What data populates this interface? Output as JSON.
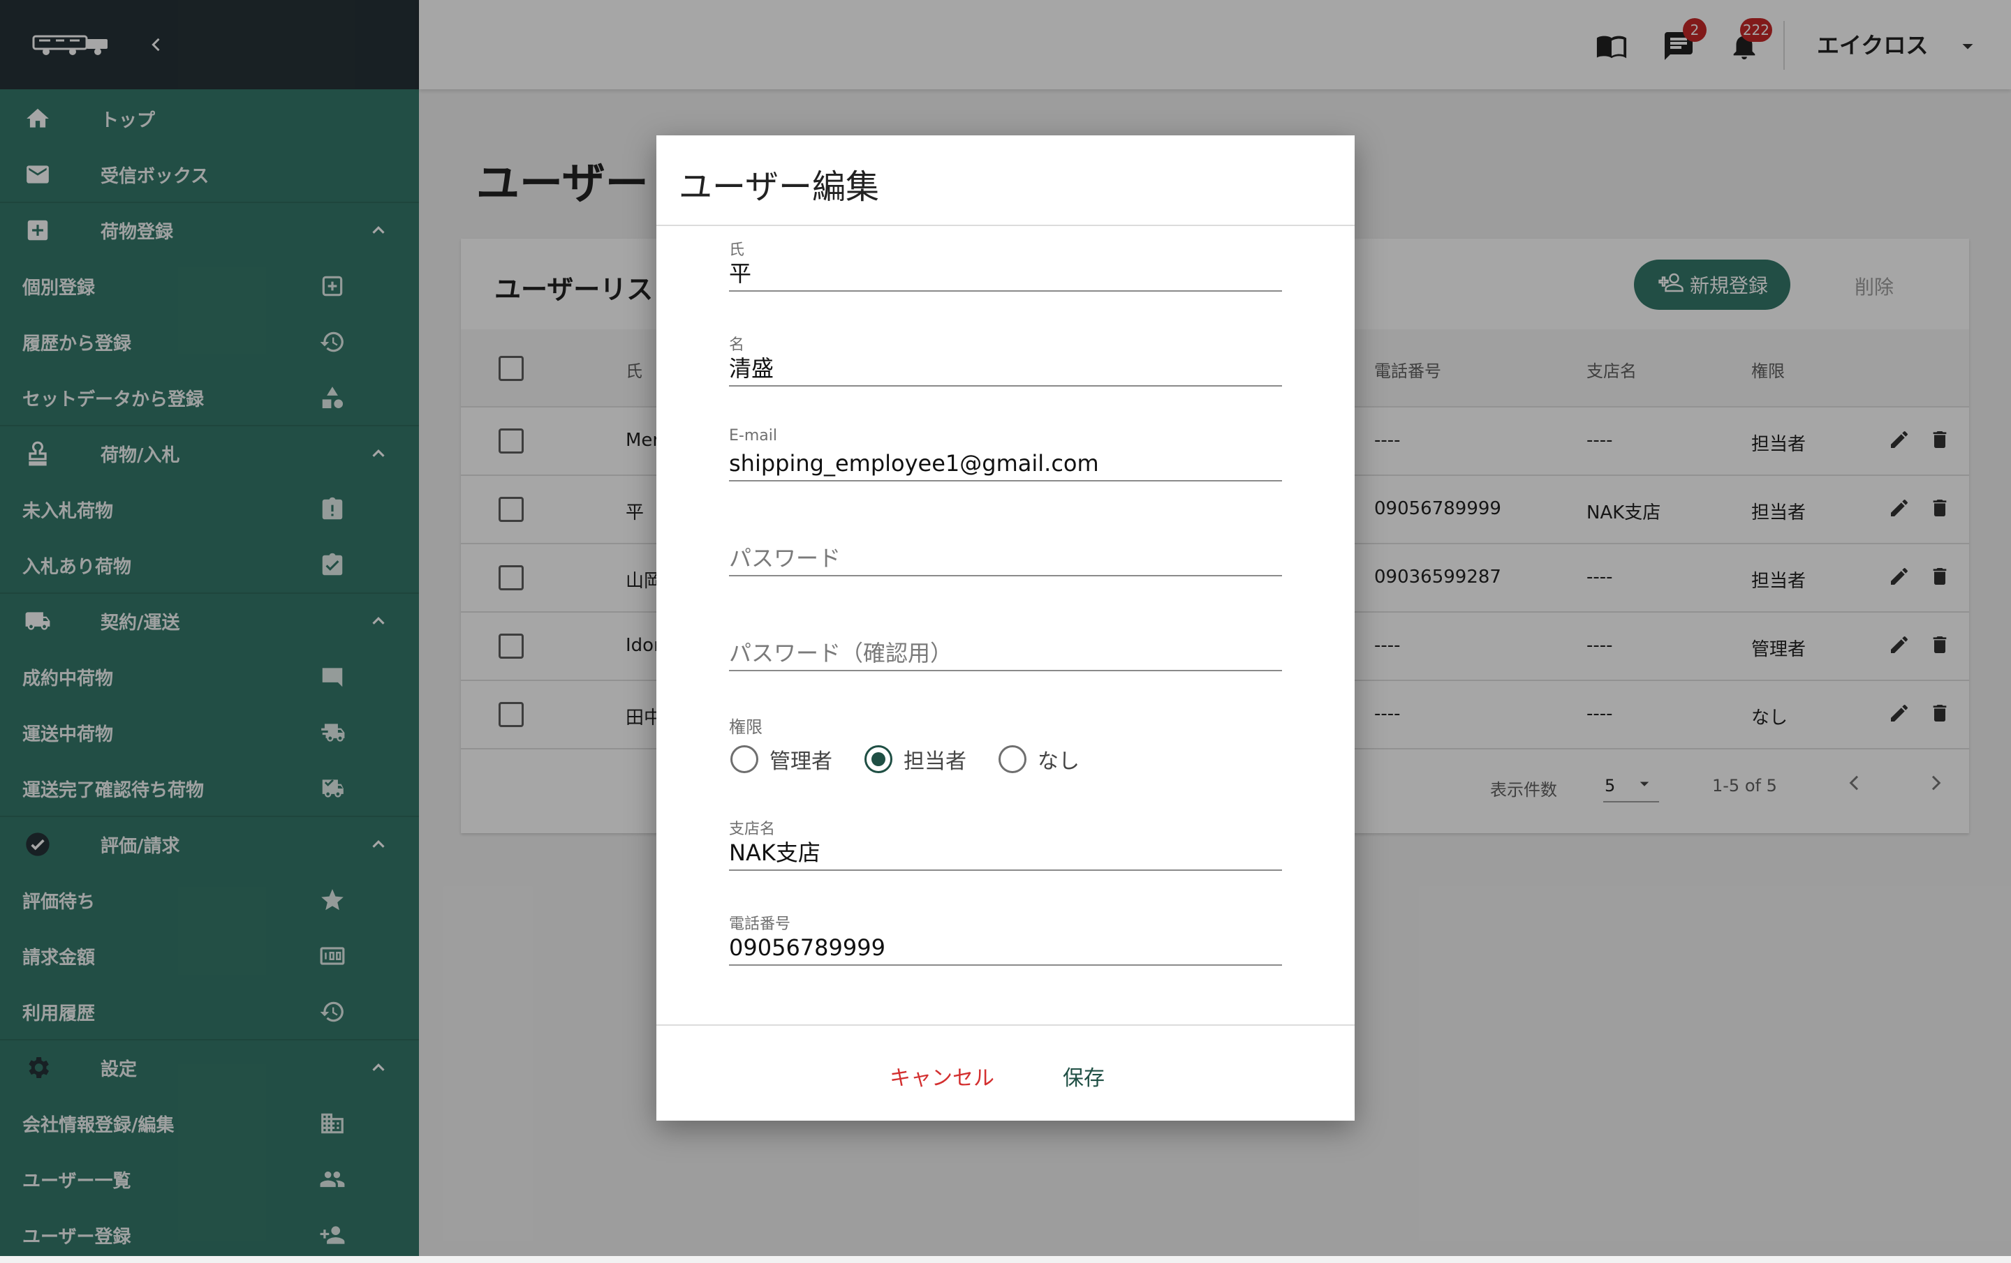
{
  "sidebar": {
    "menu": [
      {
        "label": "トップ",
        "icon": "home-icon"
      },
      {
        "label": "受信ボックス",
        "icon": "mail-icon"
      },
      {
        "label": "荷物登録",
        "icon": "add-box-icon"
      },
      {
        "label": "個別登録",
        "icon": "add-square-icon"
      },
      {
        "label": "履歴から登録",
        "icon": "history-icon"
      },
      {
        "label": "セットデータから登録",
        "icon": "shapes-icon"
      },
      {
        "label": "荷物/入札",
        "icon": "stamp-icon"
      },
      {
        "label": "未入札荷物",
        "icon": "clipboard-alert-icon"
      },
      {
        "label": "入札あり荷物",
        "icon": "clipboard-check-icon"
      },
      {
        "label": "契約/運送",
        "icon": "truck-icon"
      },
      {
        "label": "成約中荷物",
        "icon": "comment-icon"
      },
      {
        "label": "運送中荷物",
        "icon": "truck-fast-icon"
      },
      {
        "label": "運送完了確認待ち荷物",
        "icon": "truck-check-icon"
      },
      {
        "label": "評価/請求",
        "icon": "check-circle-icon"
      },
      {
        "label": "評価待ち",
        "icon": "star-icon"
      },
      {
        "label": "請求金額",
        "icon": "money-icon"
      },
      {
        "label": "利用履歴",
        "icon": "history-icon"
      },
      {
        "label": "設定",
        "icon": "gear-icon"
      },
      {
        "label": "会社情報登録/編集",
        "icon": "building-icon"
      },
      {
        "label": "ユーザー一覧",
        "icon": "people-icon"
      },
      {
        "label": "ユーザー登録",
        "icon": "person-add-icon"
      }
    ]
  },
  "header": {
    "message_badge": "2",
    "notification_badge": "222",
    "company": "エイクロス"
  },
  "main": {
    "page_title": "ユーザー",
    "card_title": "ユーザーリス",
    "add_button": "新規登録",
    "delete_button": "削除",
    "columns": {
      "last_name": "氏",
      "phone": "電話番号",
      "branch": "支店名",
      "role": "権限"
    },
    "rows": [
      {
        "last_name": "Mer",
        "phone": "----",
        "branch": "----",
        "role": "担当者"
      },
      {
        "last_name": "平",
        "phone": "09056789999",
        "branch": "NAK支店",
        "role": "担当者"
      },
      {
        "last_name": "山岡",
        "phone": "09036599287",
        "branch": "----",
        "role": "担当者"
      },
      {
        "last_name": "Idor",
        "phone": "----",
        "branch": "----",
        "role": "管理者"
      },
      {
        "last_name": "田中",
        "phone": "----",
        "branch": "----",
        "role": "なし"
      }
    ],
    "footer": {
      "rows_per_page_label": "表示件数",
      "rows_per_page": "5",
      "range": "1-5 of 5"
    }
  },
  "dialog": {
    "title": "ユーザー編集",
    "last_name": {
      "label": "氏",
      "value": "平"
    },
    "first_name": {
      "label": "名",
      "value": "清盛"
    },
    "email": {
      "label": "E-mail",
      "value": "shipping_employee1@gmail.com"
    },
    "password": {
      "placeholder": "パスワード"
    },
    "password_confirm": {
      "placeholder": "パスワード（確認用）"
    },
    "role": {
      "label": "権限",
      "options": [
        "管理者",
        "担当者",
        "なし"
      ],
      "selected": "担当者"
    },
    "branch": {
      "label": "支店名",
      "value": "NAK支店"
    },
    "phone": {
      "label": "電話番号",
      "value": "09056789999"
    },
    "cancel": "キャンセル",
    "save": "保存"
  },
  "colors": {
    "sidebar": "#35796a",
    "sidebar_header": "#263238",
    "accent": "#35796a",
    "danger": "#d32f2f",
    "badge": "#c62828"
  }
}
